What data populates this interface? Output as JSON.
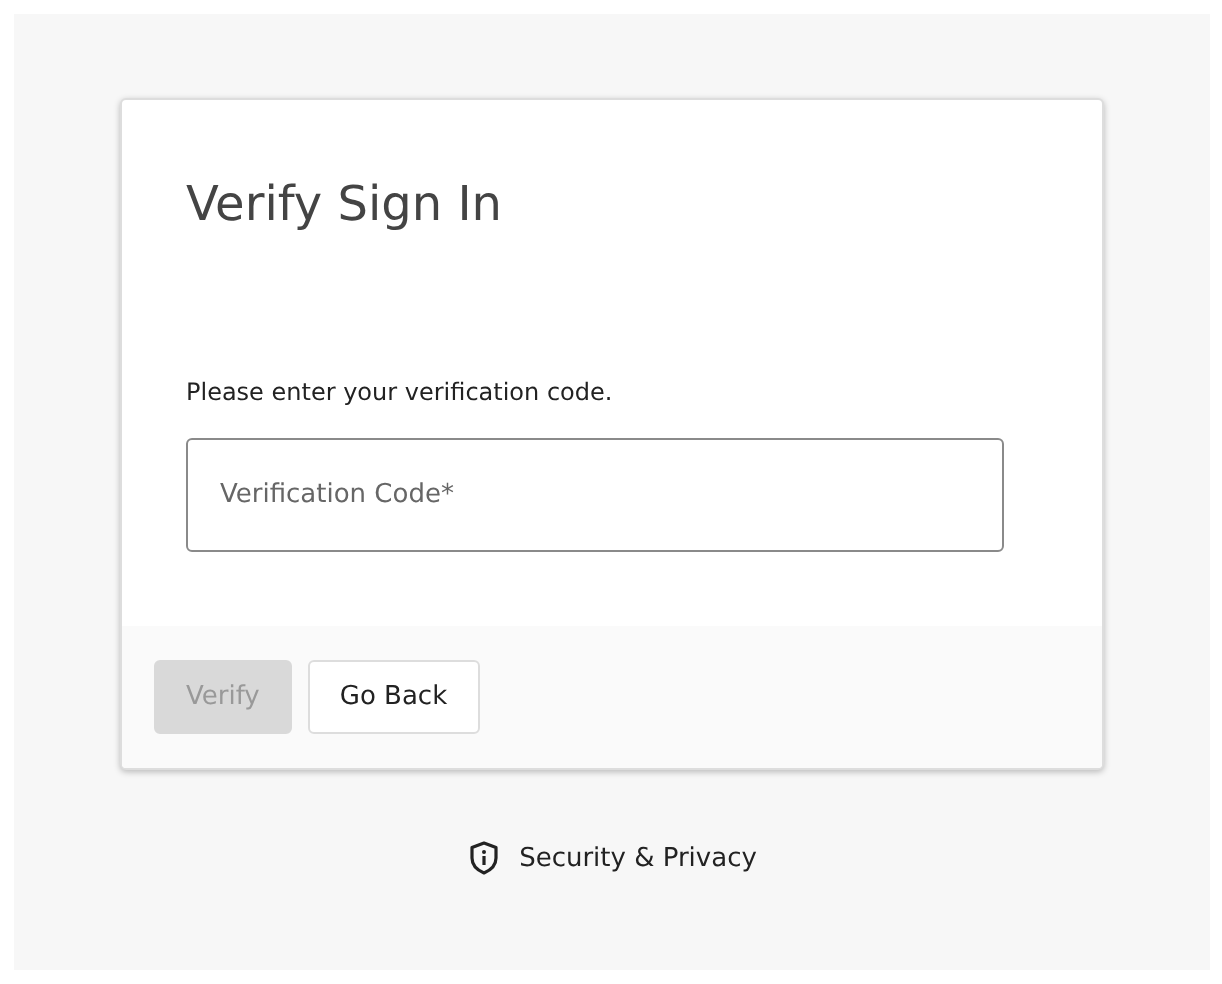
{
  "card": {
    "title": "Verify Sign In",
    "instruction": "Please enter your verification code.",
    "field": {
      "placeholder": "Verification Code*"
    },
    "buttons": [
      {
        "label": "Verify",
        "disabled": true
      },
      {
        "label": "Go Back",
        "disabled": false
      }
    ]
  },
  "footer_link": {
    "label": "Security & Privacy"
  }
}
